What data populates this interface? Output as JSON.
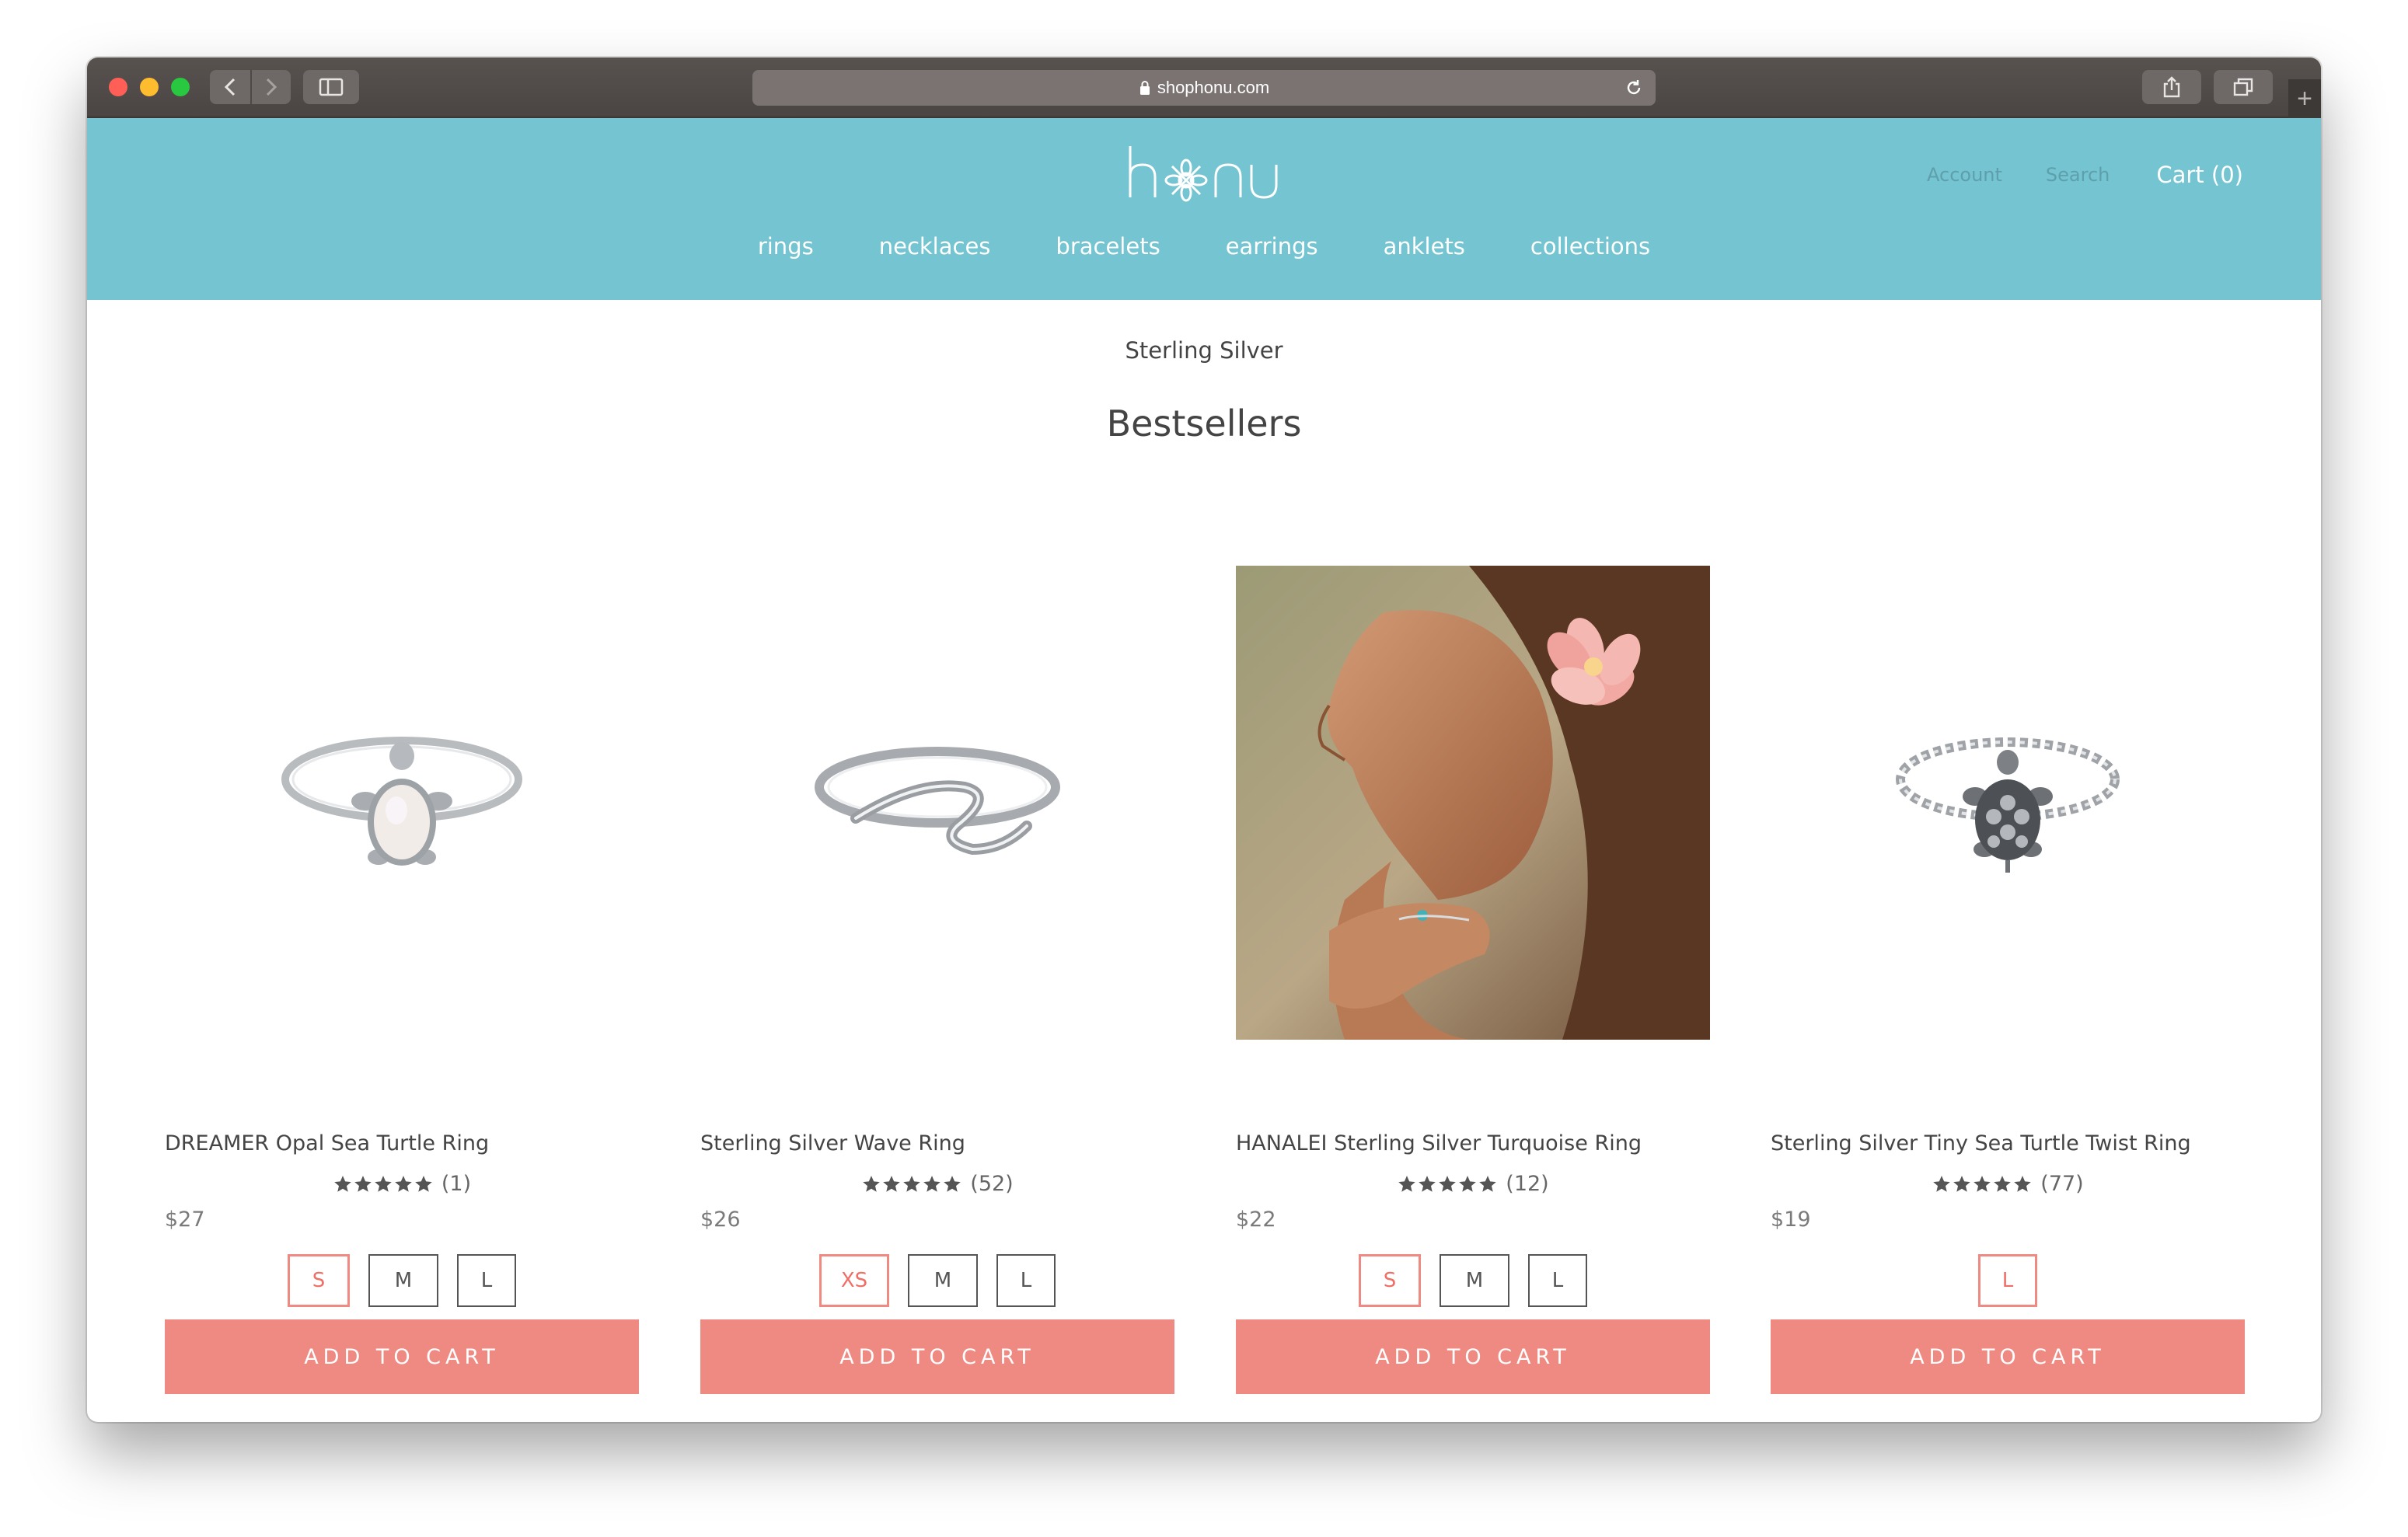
{
  "browser": {
    "url": "shophonu.com"
  },
  "header": {
    "logo_text": "honu",
    "account": "Account",
    "search": "Search",
    "cart": "Cart (0)"
  },
  "nav": [
    "rings",
    "necklaces",
    "bracelets",
    "earrings",
    "anklets",
    "collections"
  ],
  "section": {
    "kicker": "Sterling Silver",
    "title": "Bestsellers"
  },
  "colors": {
    "header_bg": "#74c4d2",
    "button": "#ef8a83",
    "selected_size": "#ef6f67"
  },
  "products": [
    {
      "name": "DREAMER Opal Sea Turtle Ring",
      "rating_count": "(1)",
      "stars": 5,
      "price": "$27",
      "sizes": [
        "S",
        "M",
        "L"
      ],
      "selected_size": "S",
      "add_label": "ADD TO CART"
    },
    {
      "name": "Sterling Silver Wave Ring",
      "rating_count": "(52)",
      "stars": 5,
      "price": "$26",
      "sizes": [
        "XS",
        "M",
        "L"
      ],
      "selected_size": "XS",
      "add_label": "ADD TO CART"
    },
    {
      "name": "HANALEI Sterling Silver Turquoise Ring",
      "rating_count": "(12)",
      "stars": 5,
      "price": "$22",
      "sizes": [
        "S",
        "M",
        "L"
      ],
      "selected_size": "S",
      "add_label": "ADD TO CART"
    },
    {
      "name": "Sterling Silver Tiny Sea Turtle Twist Ring",
      "rating_count": "(77)",
      "stars": 5,
      "price": "$19",
      "sizes": [
        "L"
      ],
      "selected_size": "L",
      "add_label": "ADD TO CART"
    }
  ]
}
